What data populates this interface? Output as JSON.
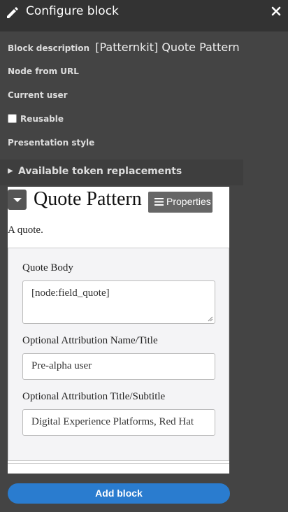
{
  "header": {
    "title": "Configure block",
    "icon": "pencil-icon",
    "close_icon": "close-icon"
  },
  "form": {
    "block_description_label": "Block description",
    "block_description_value": "[Patternkit] Quote Pattern",
    "node_from_url_label": "Node from URL",
    "current_user_label": "Current user",
    "reusable_label": "Reusable",
    "reusable_checked": false,
    "presentation_style_label": "Presentation style",
    "token_replacements_label": "Available token replacements"
  },
  "preview": {
    "title": "Quote Pattern",
    "properties_label": "Properties",
    "description": "A quote.",
    "fields": [
      {
        "label": "Quote Body",
        "value": "[node:field_quote]"
      },
      {
        "label": "Optional Attribution Name/Title",
        "value": "Pre-alpha user"
      },
      {
        "label": "Optional Attribution Title/Subtitle",
        "value": "Digital Experience Platforms, Red Hat"
      }
    ]
  },
  "actions": {
    "add_block_label": "Add block"
  },
  "colors": {
    "background": "#444444",
    "header": "#333333",
    "primary_button": "#2a7ccf"
  }
}
